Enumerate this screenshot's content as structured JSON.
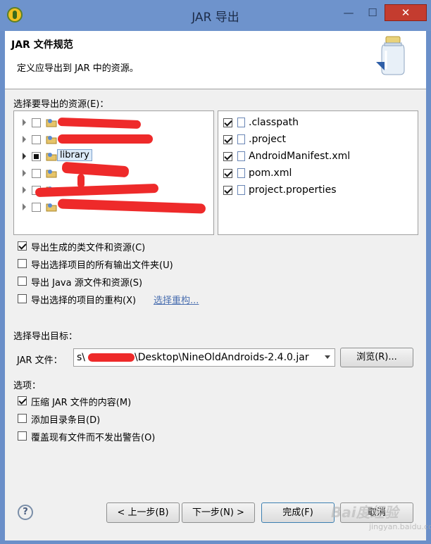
{
  "window": {
    "title": "JAR 导出",
    "minimize_label": "—",
    "maximize_label": "☐",
    "close_label": "✕"
  },
  "header": {
    "title": "JAR 文件规范",
    "description": "定义应导出到 JAR 中的资源。",
    "icon": "jar-icon"
  },
  "resources": {
    "label": "选择要导出的资源(E)：",
    "projects": [
      {
        "label": "",
        "checked": false,
        "redacted": true
      },
      {
        "label": "",
        "checked": false,
        "redacted": true
      },
      {
        "label": "library",
        "checked": "partial",
        "selected": true
      },
      {
        "label": "",
        "checked": false,
        "redacted": true
      },
      {
        "label": "",
        "checked": false,
        "redacted": true
      },
      {
        "label": "",
        "checked": false,
        "redacted": true
      }
    ],
    "files": [
      {
        "name": ".classpath",
        "checked": true
      },
      {
        "name": ".project",
        "checked": true
      },
      {
        "name": "AndroidManifest.xml",
        "checked": true
      },
      {
        "name": "pom.xml",
        "checked": true
      },
      {
        "name": "project.properties",
        "checked": true
      }
    ]
  },
  "export_options": [
    {
      "label": "导出生成的类文件和资源(C)",
      "checked": true
    },
    {
      "label": "导出选择项目的所有输出文件夹(U)",
      "checked": false
    },
    {
      "label": "导出 Java 源文件和资源(S)",
      "checked": false
    },
    {
      "label": "导出选择的项目的重构(X)",
      "checked": false
    }
  ],
  "refactor_link": "选择重构...",
  "destination": {
    "label": "选择导出目标：",
    "jar_file_label": "JAR 文件：",
    "path_prefix": "s\\",
    "path_suffix": "\\Desktop\\NineOldAndroids-2.4.0.jar",
    "browse_label": "浏览(R)..."
  },
  "options": {
    "label": "选项：",
    "items": [
      {
        "label": "压缩 JAR 文件的内容(M)",
        "checked": true
      },
      {
        "label": "添加目录条目(D)",
        "checked": false
      },
      {
        "label": "覆盖现有文件而不发出警告(O)",
        "checked": false
      }
    ]
  },
  "buttons": {
    "back": "< 上一步(B)",
    "next": "下一步(N) >",
    "finish": "完成(F)",
    "cancel": "取消",
    "help": "?"
  },
  "watermark": {
    "text": "Bai度经验",
    "sub": "jingyan.baidu.com"
  },
  "colors": {
    "title_bar": "#6e93cc",
    "close_button": "#c43c2f",
    "redaction": "#ee2a2a",
    "link": "#4a6fb0"
  }
}
